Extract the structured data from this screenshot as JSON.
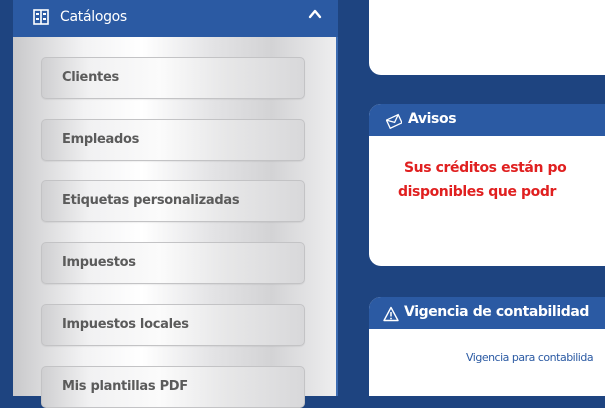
{
  "sidebar": {
    "title": "Catálogos",
    "items": [
      {
        "label": "Clientes"
      },
      {
        "label": "Empleados"
      },
      {
        "label": "Etiquetas personalizadas"
      },
      {
        "label": "Impuestos"
      },
      {
        "label": "Impuestos locales"
      },
      {
        "label": "Mis plantillas PDF"
      }
    ]
  },
  "avisos": {
    "title": "Avisos",
    "message_line1": "Sus créditos están po",
    "message_line2": "disponibles que podr"
  },
  "vigencia": {
    "title": "Vigencia de contabilidad",
    "text": "Vigencia para contabilida"
  },
  "colors": {
    "background": "#1e4480",
    "header_blue": "#2b5aa3",
    "alert_red": "#e02020",
    "item_text": "#5b5b5b"
  },
  "icons": {
    "catalog": "catalog-icon",
    "collapse": "chevron-up-icon",
    "avisos": "envelope-icon",
    "vigencia": "warning-triangle-icon"
  }
}
